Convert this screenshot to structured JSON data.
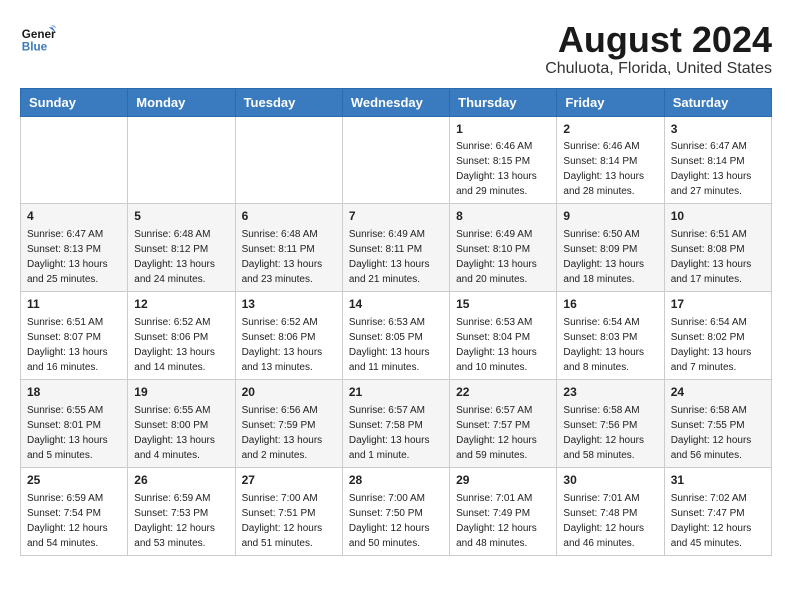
{
  "header": {
    "logo_line1": "General",
    "logo_line2": "Blue",
    "title": "August 2024",
    "subtitle": "Chuluota, Florida, United States"
  },
  "days_of_week": [
    "Sunday",
    "Monday",
    "Tuesday",
    "Wednesday",
    "Thursday",
    "Friday",
    "Saturday"
  ],
  "weeks": [
    [
      {
        "day": "",
        "info": ""
      },
      {
        "day": "",
        "info": ""
      },
      {
        "day": "",
        "info": ""
      },
      {
        "day": "",
        "info": ""
      },
      {
        "day": "1",
        "info": "Sunrise: 6:46 AM\nSunset: 8:15 PM\nDaylight: 13 hours\nand 29 minutes."
      },
      {
        "day": "2",
        "info": "Sunrise: 6:46 AM\nSunset: 8:14 PM\nDaylight: 13 hours\nand 28 minutes."
      },
      {
        "day": "3",
        "info": "Sunrise: 6:47 AM\nSunset: 8:14 PM\nDaylight: 13 hours\nand 27 minutes."
      }
    ],
    [
      {
        "day": "4",
        "info": "Sunrise: 6:47 AM\nSunset: 8:13 PM\nDaylight: 13 hours\nand 25 minutes."
      },
      {
        "day": "5",
        "info": "Sunrise: 6:48 AM\nSunset: 8:12 PM\nDaylight: 13 hours\nand 24 minutes."
      },
      {
        "day": "6",
        "info": "Sunrise: 6:48 AM\nSunset: 8:11 PM\nDaylight: 13 hours\nand 23 minutes."
      },
      {
        "day": "7",
        "info": "Sunrise: 6:49 AM\nSunset: 8:11 PM\nDaylight: 13 hours\nand 21 minutes."
      },
      {
        "day": "8",
        "info": "Sunrise: 6:49 AM\nSunset: 8:10 PM\nDaylight: 13 hours\nand 20 minutes."
      },
      {
        "day": "9",
        "info": "Sunrise: 6:50 AM\nSunset: 8:09 PM\nDaylight: 13 hours\nand 18 minutes."
      },
      {
        "day": "10",
        "info": "Sunrise: 6:51 AM\nSunset: 8:08 PM\nDaylight: 13 hours\nand 17 minutes."
      }
    ],
    [
      {
        "day": "11",
        "info": "Sunrise: 6:51 AM\nSunset: 8:07 PM\nDaylight: 13 hours\nand 16 minutes."
      },
      {
        "day": "12",
        "info": "Sunrise: 6:52 AM\nSunset: 8:06 PM\nDaylight: 13 hours\nand 14 minutes."
      },
      {
        "day": "13",
        "info": "Sunrise: 6:52 AM\nSunset: 8:06 PM\nDaylight: 13 hours\nand 13 minutes."
      },
      {
        "day": "14",
        "info": "Sunrise: 6:53 AM\nSunset: 8:05 PM\nDaylight: 13 hours\nand 11 minutes."
      },
      {
        "day": "15",
        "info": "Sunrise: 6:53 AM\nSunset: 8:04 PM\nDaylight: 13 hours\nand 10 minutes."
      },
      {
        "day": "16",
        "info": "Sunrise: 6:54 AM\nSunset: 8:03 PM\nDaylight: 13 hours\nand 8 minutes."
      },
      {
        "day": "17",
        "info": "Sunrise: 6:54 AM\nSunset: 8:02 PM\nDaylight: 13 hours\nand 7 minutes."
      }
    ],
    [
      {
        "day": "18",
        "info": "Sunrise: 6:55 AM\nSunset: 8:01 PM\nDaylight: 13 hours\nand 5 minutes."
      },
      {
        "day": "19",
        "info": "Sunrise: 6:55 AM\nSunset: 8:00 PM\nDaylight: 13 hours\nand 4 minutes."
      },
      {
        "day": "20",
        "info": "Sunrise: 6:56 AM\nSunset: 7:59 PM\nDaylight: 13 hours\nand 2 minutes."
      },
      {
        "day": "21",
        "info": "Sunrise: 6:57 AM\nSunset: 7:58 PM\nDaylight: 13 hours\nand 1 minute."
      },
      {
        "day": "22",
        "info": "Sunrise: 6:57 AM\nSunset: 7:57 PM\nDaylight: 12 hours\nand 59 minutes."
      },
      {
        "day": "23",
        "info": "Sunrise: 6:58 AM\nSunset: 7:56 PM\nDaylight: 12 hours\nand 58 minutes."
      },
      {
        "day": "24",
        "info": "Sunrise: 6:58 AM\nSunset: 7:55 PM\nDaylight: 12 hours\nand 56 minutes."
      }
    ],
    [
      {
        "day": "25",
        "info": "Sunrise: 6:59 AM\nSunset: 7:54 PM\nDaylight: 12 hours\nand 54 minutes."
      },
      {
        "day": "26",
        "info": "Sunrise: 6:59 AM\nSunset: 7:53 PM\nDaylight: 12 hours\nand 53 minutes."
      },
      {
        "day": "27",
        "info": "Sunrise: 7:00 AM\nSunset: 7:51 PM\nDaylight: 12 hours\nand 51 minutes."
      },
      {
        "day": "28",
        "info": "Sunrise: 7:00 AM\nSunset: 7:50 PM\nDaylight: 12 hours\nand 50 minutes."
      },
      {
        "day": "29",
        "info": "Sunrise: 7:01 AM\nSunset: 7:49 PM\nDaylight: 12 hours\nand 48 minutes."
      },
      {
        "day": "30",
        "info": "Sunrise: 7:01 AM\nSunset: 7:48 PM\nDaylight: 12 hours\nand 46 minutes."
      },
      {
        "day": "31",
        "info": "Sunrise: 7:02 AM\nSunset: 7:47 PM\nDaylight: 12 hours\nand 45 minutes."
      }
    ]
  ]
}
